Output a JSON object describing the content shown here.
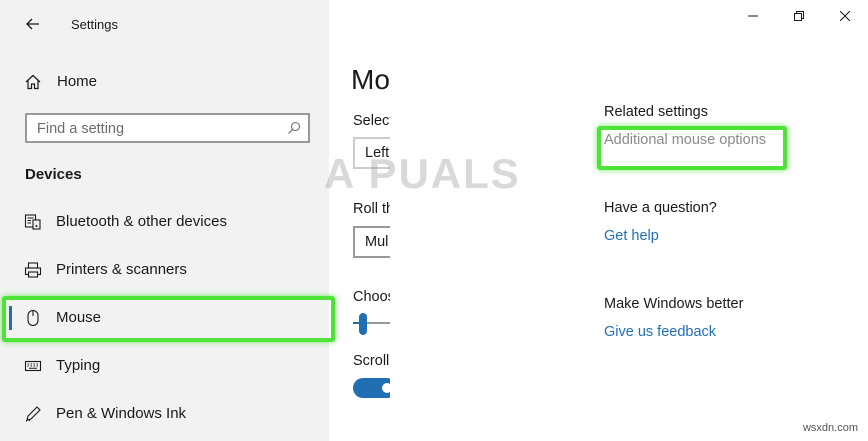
{
  "app": {
    "title": "Settings"
  },
  "sidebar": {
    "home_label": "Home",
    "search_placeholder": "Find a setting",
    "section_header": "Devices",
    "items": [
      {
        "label": "Bluetooth & other devices",
        "icon": "bluetooth-devices-icon",
        "selected": false
      },
      {
        "label": "Printers & scanners",
        "icon": "printer-icon",
        "selected": false
      },
      {
        "label": "Mouse",
        "icon": "mouse-icon",
        "selected": true
      },
      {
        "label": "Typing",
        "icon": "keyboard-icon",
        "selected": false
      },
      {
        "label": "Pen & Windows Ink",
        "icon": "pen-icon",
        "selected": false
      }
    ]
  },
  "main": {
    "page_title": "Mo",
    "settings": {
      "primary_button_label": "Select",
      "primary_button_value": "Left",
      "scroll_wheel_label": "Roll th",
      "scroll_wheel_value": "Mul",
      "lines_label": "Choos",
      "scroll_inactive_label": "Scroll"
    },
    "related": {
      "heading": "Related settings",
      "link": "Additional mouse options"
    },
    "question": {
      "heading": "Have a question?",
      "link": "Get help"
    },
    "better": {
      "heading": "Make Windows better",
      "link": "Give us feedback"
    }
  },
  "watermark": "A  PUALS",
  "corner_mark": "wsxdn.com",
  "colors": {
    "accent": "#1f6fb2",
    "highlight": "#4fe33a",
    "sidebar_bg": "#f2f2f2"
  }
}
